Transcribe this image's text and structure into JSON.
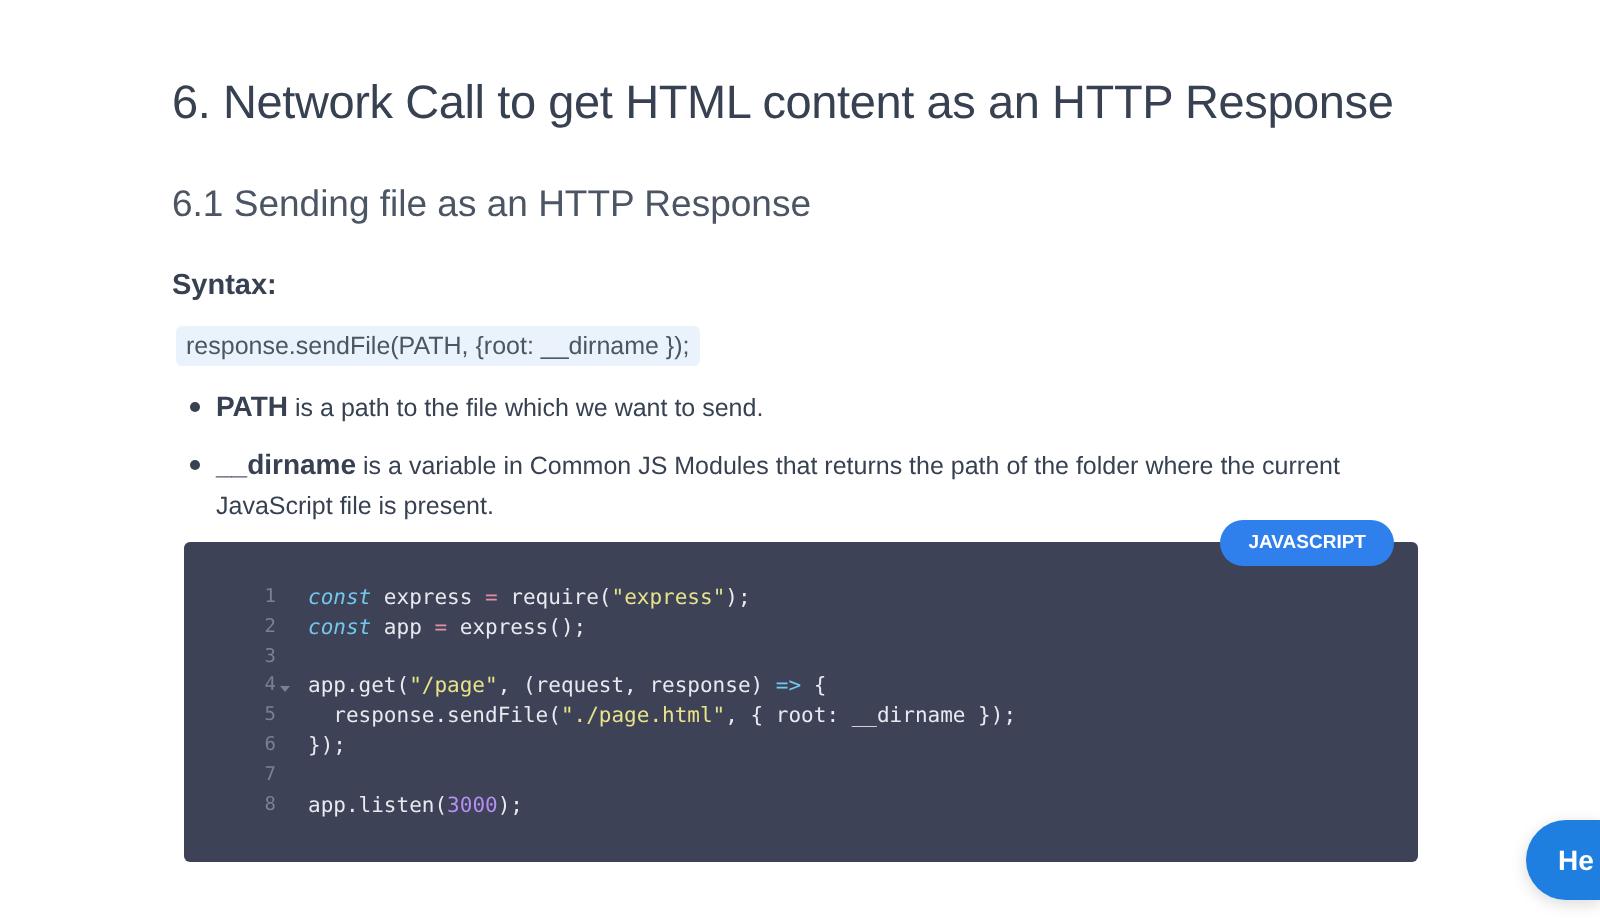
{
  "heading": "6. Network Call to get HTML content as an HTTP Response",
  "subheading": "6.1 Sending file as an HTTP Response",
  "syntax_label": "Syntax:",
  "syntax_code": "response.sendFile(PATH, {root: __dirname });",
  "bullets": [
    "**PATH** is a path to the file which we want to send.",
    "**__dirname** is a variable in Common JS Modules that returns the path of the folder where the current JavaScript file is present."
  ],
  "code_block": {
    "language": "JAVASCRIPT",
    "lines": [
      {
        "number": "1",
        "foldable": false,
        "tokens": [
          {
            "kind": "keyword",
            "text": "const"
          },
          {
            "kind": "plain",
            "text": " express "
          },
          {
            "kind": "operator",
            "text": "="
          },
          {
            "kind": "plain",
            "text": " require("
          },
          {
            "kind": "string",
            "text": "\"express\""
          },
          {
            "kind": "plain",
            "text": ");"
          }
        ]
      },
      {
        "number": "2",
        "foldable": false,
        "tokens": [
          {
            "kind": "keyword",
            "text": "const"
          },
          {
            "kind": "plain",
            "text": " app "
          },
          {
            "kind": "operator",
            "text": "="
          },
          {
            "kind": "plain",
            "text": " express();"
          }
        ]
      },
      {
        "number": "3",
        "foldable": false
      },
      {
        "number": "4",
        "foldable": true,
        "tokens": [
          {
            "kind": "plain",
            "text": "app.get("
          },
          {
            "kind": "string",
            "text": "\"/page\""
          },
          {
            "kind": "plain",
            "text": ", (request, response) "
          },
          {
            "kind": "arrow",
            "text": "=>"
          },
          {
            "kind": "plain",
            "text": " {"
          }
        ]
      },
      {
        "number": "5",
        "foldable": false,
        "tokens": [
          {
            "kind": "plain",
            "text": "  response.sendFile("
          },
          {
            "kind": "string",
            "text": "\"./page.html\""
          },
          {
            "kind": "plain",
            "text": ", { root: __dirname });"
          }
        ]
      },
      {
        "number": "6",
        "foldable": false,
        "tokens": [
          {
            "kind": "plain",
            "text": "});"
          }
        ]
      },
      {
        "number": "7",
        "foldable": false
      },
      {
        "number": "8",
        "foldable": false,
        "tokens": [
          {
            "kind": "plain",
            "text": "app.listen("
          },
          {
            "kind": "number",
            "text": "3000"
          },
          {
            "kind": "plain",
            "text": ");"
          }
        ]
      }
    ]
  },
  "help_button": "He"
}
